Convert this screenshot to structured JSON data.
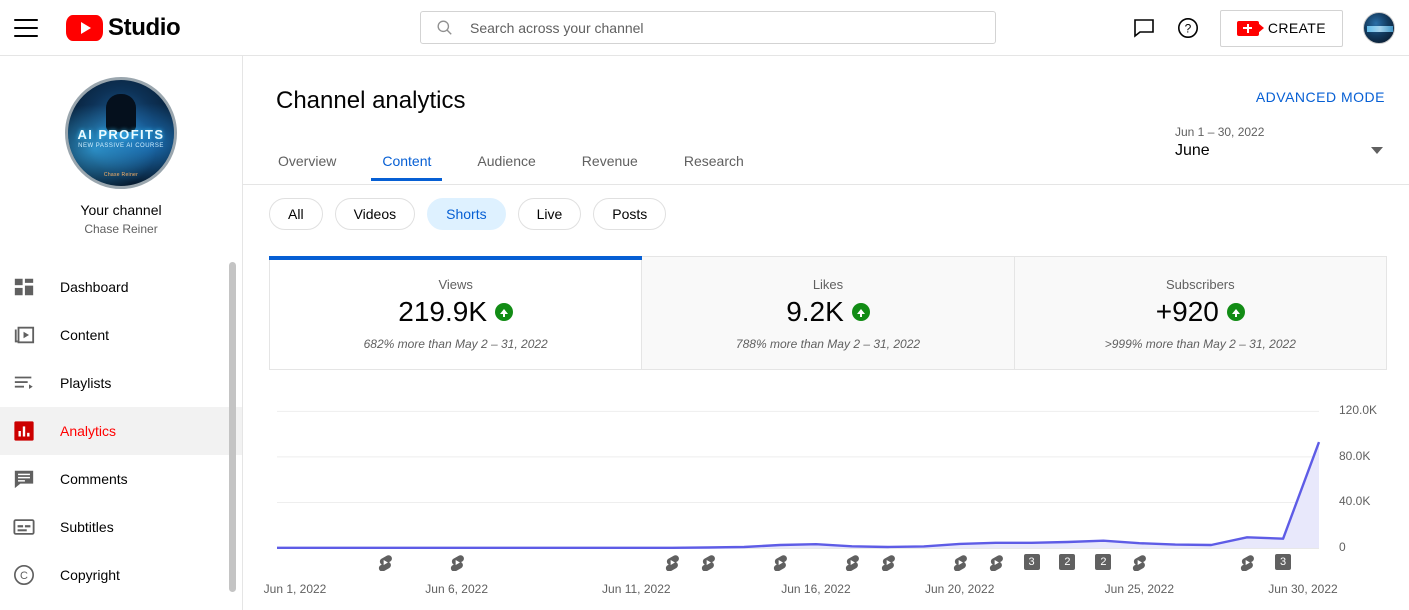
{
  "topbar": {
    "menu_icon": "hamburger-icon",
    "brand": "Studio",
    "search": {
      "placeholder": "Search across your channel",
      "value": ""
    },
    "feedback_icon": "feedback-icon",
    "help_icon": "help-icon",
    "create_label": "CREATE",
    "avatar": "account-avatar"
  },
  "sidebar": {
    "channel": {
      "avatar_title": "AI PROFITS",
      "avatar_subtitle": "NEW PASSIVE AI COURSE",
      "avatar_badge": "Chase Reiner",
      "your_channel": "Your channel",
      "name": "Chase Reiner"
    },
    "items": [
      {
        "label": "Dashboard",
        "icon": "dashboard-icon",
        "active": false
      },
      {
        "label": "Content",
        "icon": "content-icon",
        "active": false
      },
      {
        "label": "Playlists",
        "icon": "playlists-icon",
        "active": false
      },
      {
        "label": "Analytics",
        "icon": "analytics-icon",
        "active": true
      },
      {
        "label": "Comments",
        "icon": "comments-icon",
        "active": false
      },
      {
        "label": "Subtitles",
        "icon": "subtitles-icon",
        "active": false
      },
      {
        "label": "Copyright",
        "icon": "copyright-icon",
        "active": false
      }
    ]
  },
  "main": {
    "page_title": "Channel analytics",
    "advanced_mode": "ADVANCED MODE",
    "tabs": [
      {
        "label": "Overview",
        "active": false
      },
      {
        "label": "Content",
        "active": true
      },
      {
        "label": "Audience",
        "active": false
      },
      {
        "label": "Revenue",
        "active": false
      },
      {
        "label": "Research",
        "active": false
      }
    ],
    "date_range": {
      "range": "Jun 1 – 30, 2022",
      "label": "June"
    },
    "chips": [
      {
        "label": "All",
        "selected": false
      },
      {
        "label": "Videos",
        "selected": false
      },
      {
        "label": "Shorts",
        "selected": true
      },
      {
        "label": "Live",
        "selected": false
      },
      {
        "label": "Posts",
        "selected": false
      }
    ],
    "cards": [
      {
        "label": "Views",
        "value": "219.9K",
        "delta": "682% more than May 2 – 31, 2022",
        "trend": "up",
        "active": true
      },
      {
        "label": "Likes",
        "value": "9.2K",
        "delta": "788% more than May 2 – 31, 2022",
        "trend": "up",
        "active": false
      },
      {
        "label": "Subscribers",
        "value": "+920",
        "delta": ">999% more than May 2 – 31, 2022",
        "trend": "up",
        "active": false
      }
    ]
  },
  "chart_data": {
    "type": "area",
    "title": "Views",
    "xlabel": "",
    "ylabel": "Views",
    "ylim": [
      0,
      130000
    ],
    "yticks": [
      0,
      40000,
      80000,
      120000
    ],
    "ytick_labels": [
      "0",
      "40.0K",
      "80.0K",
      "120.0K"
    ],
    "grid": true,
    "line_color": "#5e5ce6",
    "fill_color": "#e8e8fb",
    "xtick_labels": [
      "Jun 1, 2022",
      "Jun 6, 2022",
      "Jun 11, 2022",
      "Jun 16, 2022",
      "Jun 20, 2022",
      "Jun 25, 2022",
      "Jun 30, 2022"
    ],
    "xtick_days": [
      1,
      6,
      11,
      16,
      20,
      25,
      30
    ],
    "x": [
      1,
      2,
      3,
      4,
      5,
      6,
      7,
      8,
      9,
      10,
      11,
      12,
      13,
      14,
      15,
      16,
      17,
      18,
      19,
      20,
      21,
      22,
      23,
      24,
      25,
      26,
      27,
      28,
      29,
      30
    ],
    "values": [
      150,
      150,
      150,
      150,
      150,
      150,
      150,
      150,
      150,
      160,
      170,
      200,
      400,
      900,
      2600,
      3300,
      1500,
      900,
      1400,
      3600,
      4600,
      4600,
      5300,
      6400,
      4200,
      3000,
      2600,
      9400,
      8200,
      93000
    ],
    "markers": [
      {
        "day": 4,
        "type": "shorts"
      },
      {
        "day": 6,
        "type": "shorts"
      },
      {
        "day": 12,
        "type": "shorts"
      },
      {
        "day": 13,
        "type": "shorts"
      },
      {
        "day": 15,
        "type": "shorts"
      },
      {
        "day": 17,
        "type": "shorts"
      },
      {
        "day": 18,
        "type": "shorts"
      },
      {
        "day": 20,
        "type": "shorts"
      },
      {
        "day": 21,
        "type": "shorts"
      },
      {
        "day": 22,
        "type": "badge",
        "count": "3"
      },
      {
        "day": 23,
        "type": "badge",
        "count": "2"
      },
      {
        "day": 24,
        "type": "badge",
        "count": "2"
      },
      {
        "day": 25,
        "type": "shorts"
      },
      {
        "day": 28,
        "type": "shorts"
      },
      {
        "day": 29,
        "type": "badge",
        "count": "3"
      }
    ]
  }
}
